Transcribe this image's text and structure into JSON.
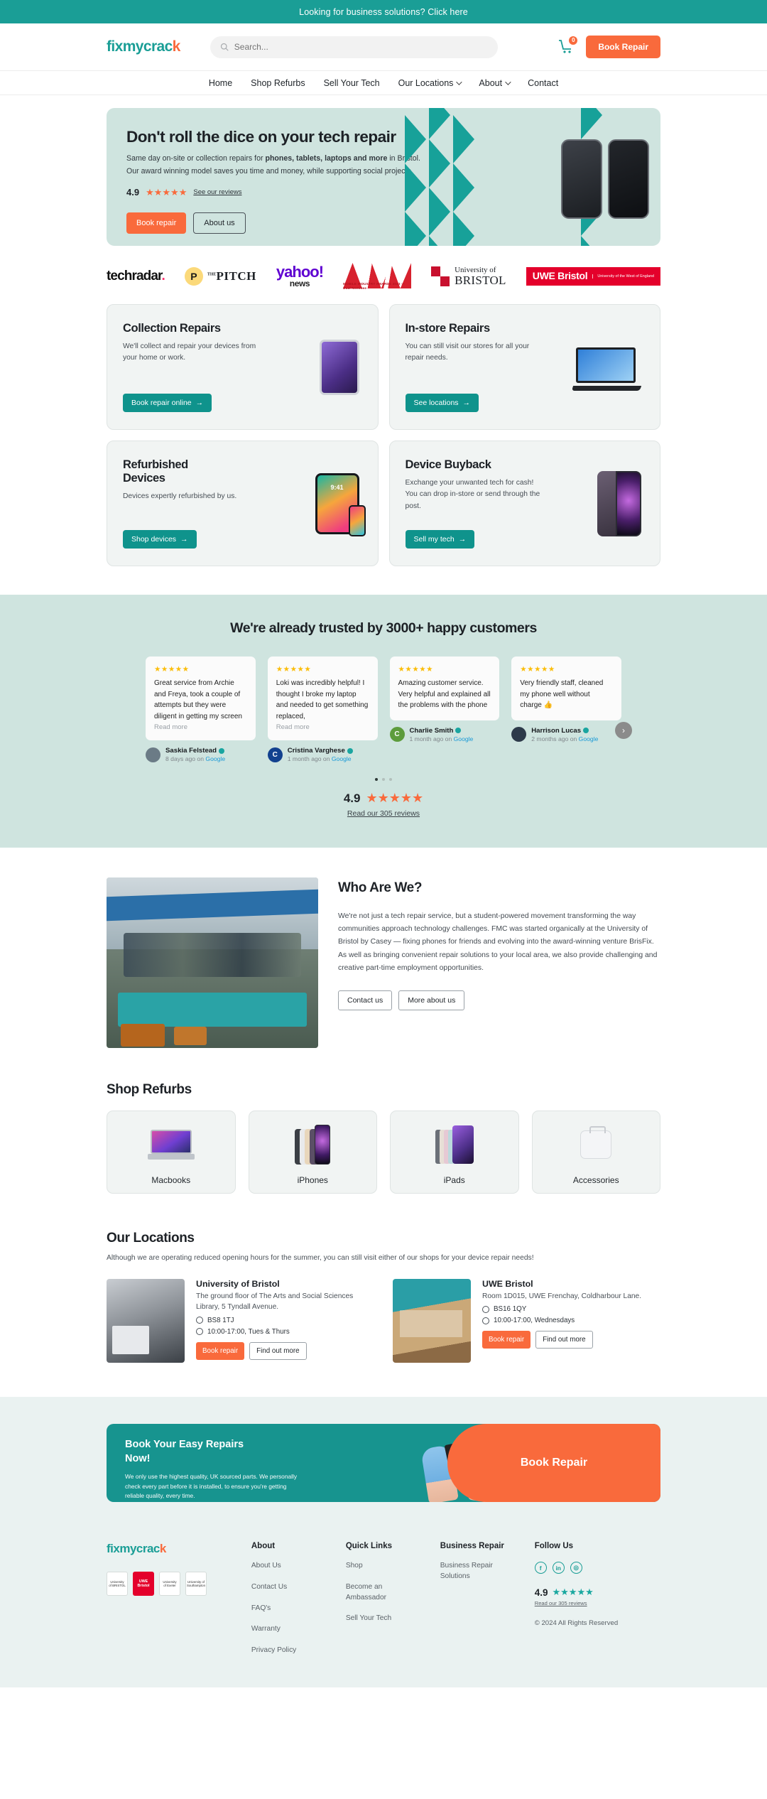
{
  "topbar": {
    "text": "Looking for business solutions? Click here"
  },
  "header": {
    "logo": "fixmycrac",
    "logo_k": "k",
    "search_placeholder": "Search...",
    "cart_count": "0",
    "book_repair": "Book Repair"
  },
  "nav": {
    "items": [
      {
        "label": "Home",
        "caret": false
      },
      {
        "label": "Shop Refurbs",
        "caret": false
      },
      {
        "label": "Sell Your Tech",
        "caret": false
      },
      {
        "label": "Our Locations",
        "caret": true
      },
      {
        "label": "About",
        "caret": true
      },
      {
        "label": "Contact",
        "caret": false
      }
    ]
  },
  "hero": {
    "title": "Don't roll the dice on your tech repair",
    "line1_a": "Same day on-site or collection repairs for ",
    "line1_b": "phones, tablets, laptops and more",
    "line1_c": " in Bristol.",
    "line2": "Our award winning model saves you time and money, while supporting social projects.",
    "rating": "4.9",
    "stars": "★★★★★",
    "see_reviews": "See our reviews",
    "btn_primary": "Book repair",
    "btn_secondary": "About us"
  },
  "press": {
    "techradar": "techradar",
    "techradar_dot": ".",
    "pitch_the": "THE",
    "pitch": "PITCH",
    "pitch_mark": "P",
    "yahoo": "yahoo!",
    "yahoo_news": "news",
    "mia_caption": "MOBILE INDUSTRY AWARDS 2023 — Dual Nominee",
    "uob_a": "University of",
    "uob_b": "BRISTOL",
    "uwe_a": "UWE Bristol",
    "uwe_b": "University of the West of England"
  },
  "services": [
    {
      "title": "Collection Repairs",
      "desc": "We'll collect and repair your devices from your home or work.",
      "cta": "Book repair online",
      "icon": "ipad-purple-icon"
    },
    {
      "title": "In-store Repairs",
      "desc": "You can still visit our stores for all your repair needs.",
      "cta": "See locations",
      "icon": "laptop-icon"
    },
    {
      "title": "Refurbished Devices",
      "desc": "Devices expertly refurbished by us.",
      "cta": "Shop devices",
      "icon": "tablet-phone-icon"
    },
    {
      "title": "Device Buyback",
      "desc": "Exchange your unwanted tech for cash! You can drop in-store or send through the post.",
      "cta": "Sell my tech",
      "icon": "iphone-purple-icon"
    }
  ],
  "trusted": {
    "heading": "We're already trusted by 3000+ happy customers",
    "next_arrow": "›",
    "reviews": [
      {
        "stars": "★★★★★",
        "text": "Great service from Archie and Freya, took a couple of attempts but they were diligent in getting my screen",
        "read_more": "Read more",
        "name": "Saskia Felstead",
        "when": "8 days ago on ",
        "source": "Google",
        "avatar_letter": "",
        "avatar_color": "#6b7b86"
      },
      {
        "stars": "★★★★★",
        "text": "Loki was incredibly helpful! I thought I broke my laptop and needed to get something replaced,",
        "read_more": "Read more",
        "name": "Cristina Varghese",
        "when": "1 month ago on ",
        "source": "Google",
        "avatar_letter": "C",
        "avatar_color": "#12418f"
      },
      {
        "stars": "★★★★★",
        "text": "Amazing customer service. Very helpful and explained all the problems with the phone",
        "read_more": "",
        "name": "Charlie Smith",
        "when": "1 month ago on ",
        "source": "Google",
        "avatar_letter": "C",
        "avatar_color": "#5d9c3c"
      },
      {
        "stars": "★★★★★",
        "text": "Very friendly staff, cleaned my phone well without charge 👍",
        "read_more": "",
        "name": "Harrison Lucas",
        "when": "2 months ago on ",
        "source": "Google",
        "avatar_letter": "",
        "avatar_color": "#2d3a4a"
      }
    ],
    "overall_rating": "4.9",
    "overall_stars": "★★★★★",
    "read_reviews": "Read our 305 reviews"
  },
  "who": {
    "title": "Who Are We?",
    "para1": "We're not just a tech repair service, but a student-powered movement transforming the way communities approach technology challenges. FMC was started organically at the University of Bristol by Casey — fixing phones for friends and evolving into the award-winning venture BrisFix.",
    "para2": "As well as bringing convenient repair solutions to your local area, we also provide challenging and creative part-time employment opportunities.",
    "btn1": "Contact us",
    "btn2": "More about us"
  },
  "refurbs": {
    "title": "Shop Refurbs",
    "items": [
      {
        "label": "Macbooks",
        "icon": "macbook-icon"
      },
      {
        "label": "iPhones",
        "icon": "iphone-lineup-icon"
      },
      {
        "label": "iPads",
        "icon": "ipad-lineup-icon"
      },
      {
        "label": "Accessories",
        "icon": "charger-icon"
      }
    ]
  },
  "locations": {
    "title": "Our Locations",
    "subtitle": "Although we are operating reduced opening hours for the summer, you can still visit either of our shops for your device repair needs!",
    "items": [
      {
        "name": "University of Bristol",
        "address": "The ground floor of The Arts and Social Sciences Library, 5 Tyndall Avenue.",
        "postcode": "BS8 1TJ",
        "hours": "10:00-17:00, Tues & Thurs",
        "btn1": "Book repair",
        "btn2": "Find out more"
      },
      {
        "name": "UWE Bristol",
        "address": "Room 1D015, UWE Frenchay, Coldharbour Lane.",
        "postcode": "BS16 1QY",
        "hours": "10:00-17:00, Wednesdays",
        "btn1": "Book repair",
        "btn2": "Find out more"
      }
    ]
  },
  "cta": {
    "title": "Book Your Easy Repairs Now!",
    "desc": "We only use the highest quality, UK sourced parts. We personally check every part before it is installed, to ensure you're getting reliable quality, every time.",
    "button": "Book Repair"
  },
  "footer": {
    "logo": "fixmycrac",
    "logo_k": "k",
    "badges": [
      {
        "text": "University of BRISTOL",
        "red": false
      },
      {
        "text": "UWE Bristol",
        "red": true
      },
      {
        "text": "University of Exeter",
        "red": false
      },
      {
        "text": "University of Southampton",
        "red": false
      }
    ],
    "columns": [
      {
        "heading": "About",
        "links": [
          "About Us",
          "Contact Us",
          "FAQ's",
          "Warranty",
          "Privacy Policy"
        ]
      },
      {
        "heading": "Quick Links",
        "links": [
          "Shop",
          "Become an Ambassador",
          "Sell Your Tech"
        ]
      },
      {
        "heading": "Business Repair",
        "links": [
          "Business Repair Solutions"
        ]
      }
    ],
    "follow_heading": "Follow Us",
    "socials": [
      {
        "name": "facebook-icon",
        "glyph": "f"
      },
      {
        "name": "linkedin-icon",
        "glyph": "in"
      },
      {
        "name": "instagram-icon",
        "glyph": "◎"
      }
    ],
    "rating": "4.9",
    "stars": "★★★★★",
    "reviews_link": "Read our 305 reviews",
    "copyright": "© 2024 All Rights Reserved"
  },
  "colors": {
    "teal": "#1a9e96",
    "teal_dark": "#0f938c",
    "orange": "#f96a3c",
    "hero_bg": "#cfe4df",
    "card_bg": "#f1f4f3"
  }
}
